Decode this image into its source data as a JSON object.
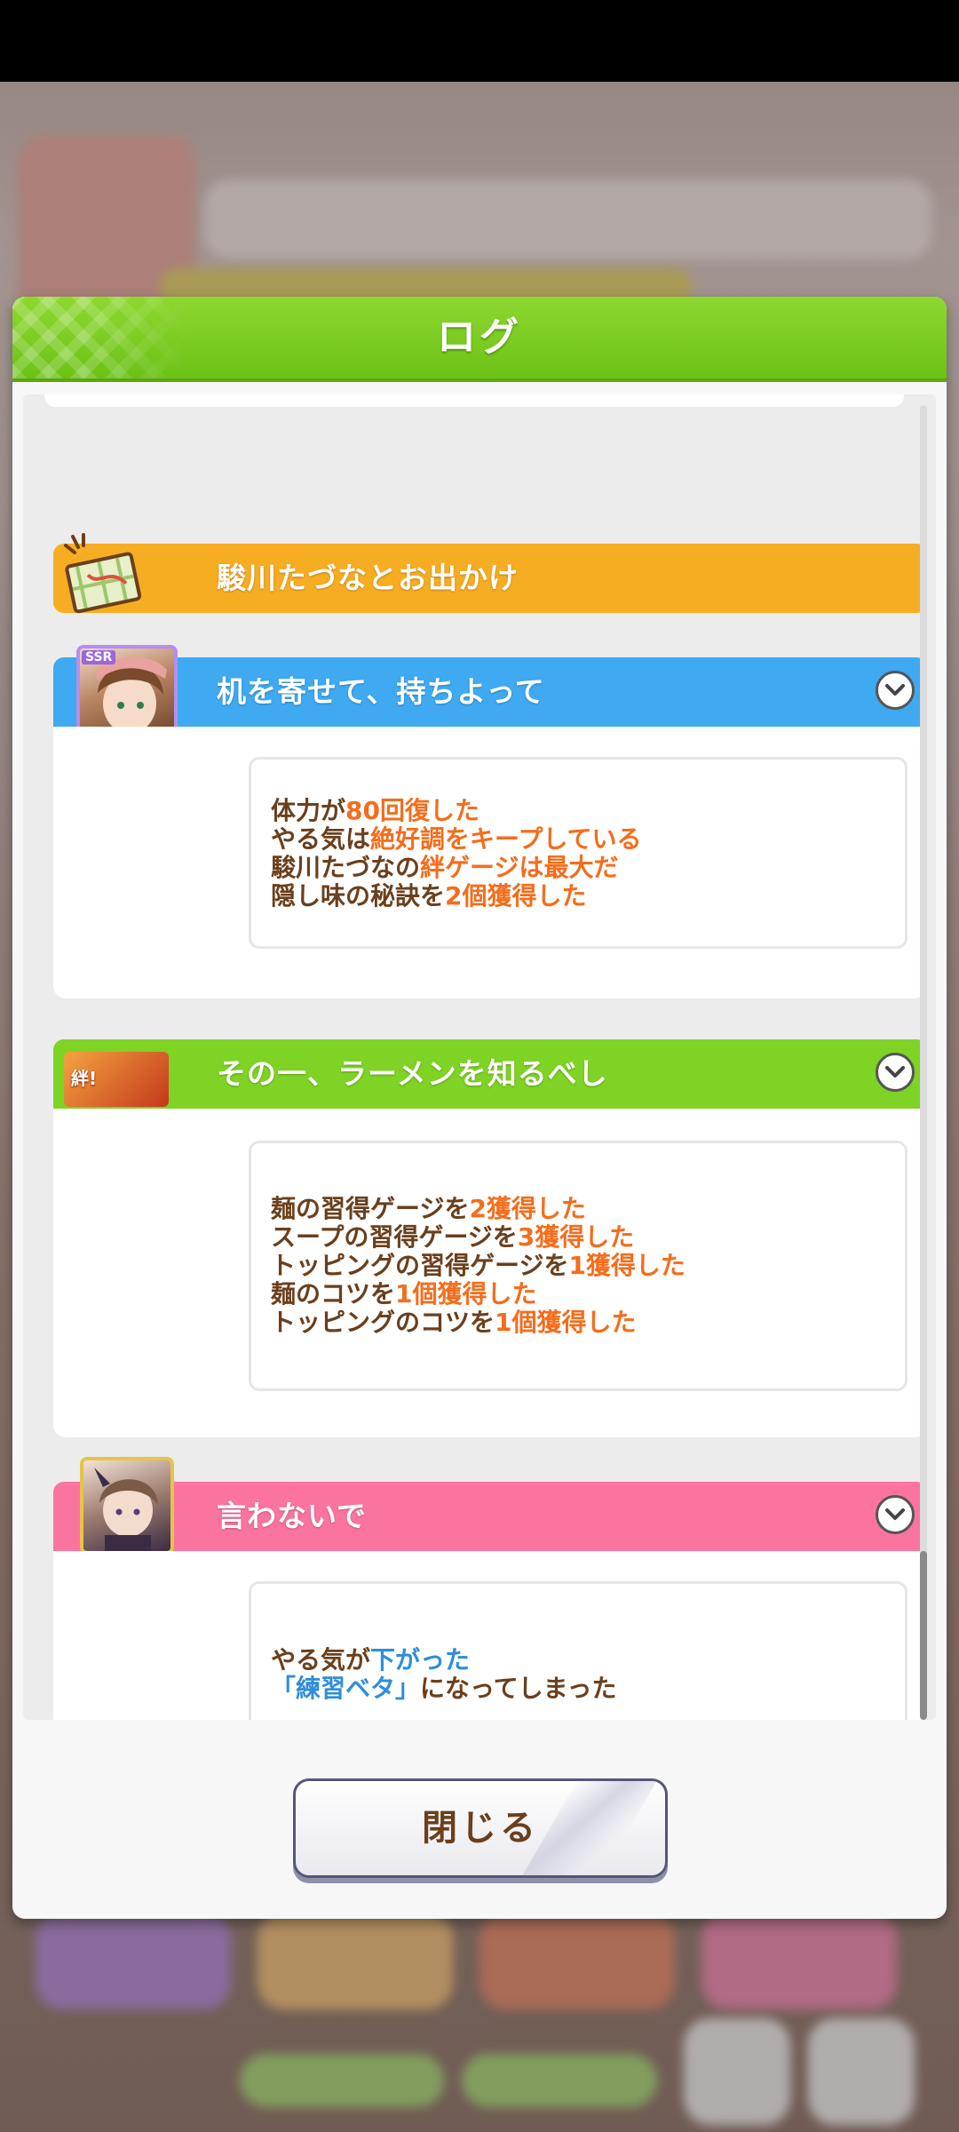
{
  "modal": {
    "title": "ログ",
    "close_label": "閉じる"
  },
  "events": [
    {
      "title": "駿川たづなとお出かけ",
      "color": "#f7ad22",
      "icon": "map-icon"
    },
    {
      "title": "机を寄せて、持ちよって",
      "color": "#3fa9f2",
      "icon": "ssr-card-portrait",
      "badge": "SSR",
      "lines": [
        {
          "a": "体力が",
          "b": "80回復した",
          "c": ""
        },
        {
          "a": "やる気は",
          "b": "絶好調をキープしている",
          "c": ""
        },
        {
          "a": "駿川たづなの",
          "b": "絆ゲージは最大だ",
          "c": ""
        },
        {
          "a": "隠し味の秘訣を",
          "b": "2個獲得した",
          "c": ""
        }
      ]
    },
    {
      "title": "その一、ラーメンを知るべし",
      "color": "#7ed324",
      "icon": "scenario-event-icon",
      "lines": [
        {
          "a": "麺の習得ゲージを",
          "b": "2獲得した"
        },
        {
          "a": "スープの習得ゲージを",
          "b": "3獲得した"
        },
        {
          "a": "トッピングの習得ゲージを",
          "b": "1獲得した"
        },
        {
          "a": "麺のコツを",
          "b": "1個獲得した"
        },
        {
          "a": "トッピングのコツを",
          "b": "1個獲得した"
        }
      ]
    },
    {
      "title": "言わないで",
      "color": "#fb74a0",
      "icon": "character-portrait",
      "lines": [
        {
          "a": "やる気が",
          "b": "下がった"
        },
        {
          "a": "",
          "b": "「練習ベタ」",
          "c": "になってしまった"
        }
      ]
    }
  ],
  "scroll": {
    "position": 0.92
  }
}
